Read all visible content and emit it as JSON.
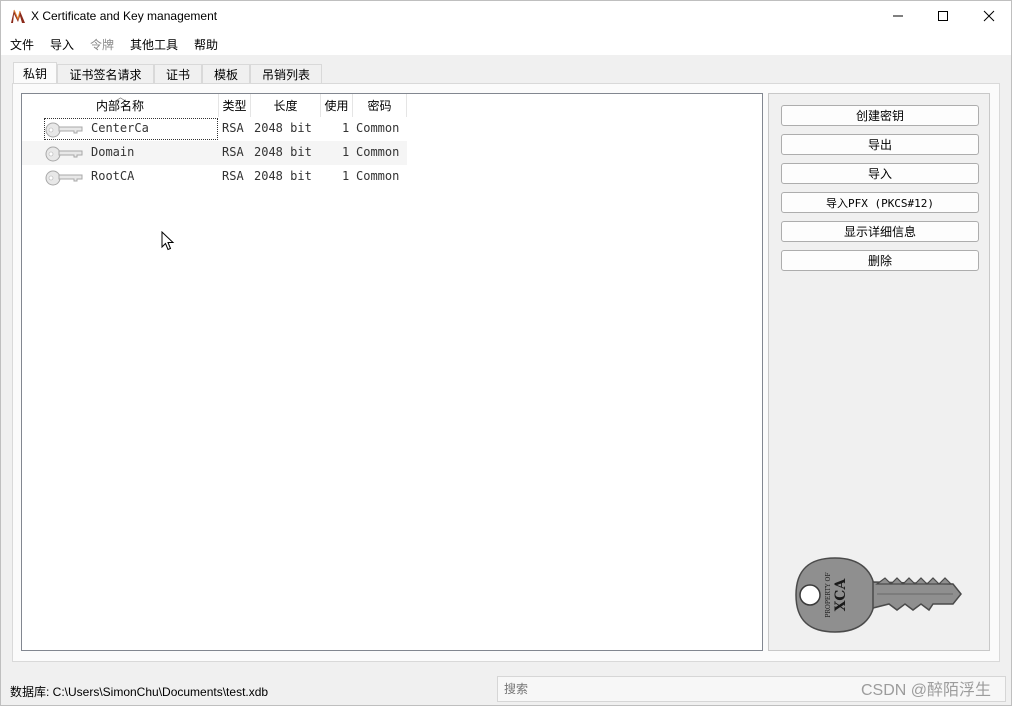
{
  "window": {
    "title": "X Certificate and Key management",
    "controls": [
      "minimize-icon",
      "maximize-icon",
      "close-icon"
    ]
  },
  "menu": {
    "items": [
      {
        "label": "文件",
        "enabled": true
      },
      {
        "label": "导入",
        "enabled": true
      },
      {
        "label": "令牌",
        "enabled": false
      },
      {
        "label": "其他工具",
        "enabled": true
      },
      {
        "label": "帮助",
        "enabled": true
      }
    ]
  },
  "tabs": [
    {
      "label": "私钥",
      "active": true
    },
    {
      "label": "证书签名请求",
      "active": false
    },
    {
      "label": "证书",
      "active": false
    },
    {
      "label": "模板",
      "active": false
    },
    {
      "label": "吊销列表",
      "active": false
    }
  ],
  "table": {
    "columns": [
      "内部名称",
      "类型",
      "长度",
      "使用",
      "密码"
    ],
    "rows": [
      {
        "name": "CenterCa",
        "type": "RSA",
        "length": "2048 bit",
        "use": "1",
        "password": "Common"
      },
      {
        "name": "Domain",
        "type": "RSA",
        "length": "2048 bit",
        "use": "1",
        "password": "Common"
      },
      {
        "name": "RootCA",
        "type": "RSA",
        "length": "2048 bit",
        "use": "1",
        "password": "Common"
      }
    ],
    "row_icon": "key-icon"
  },
  "actions": {
    "create": "创建密钥",
    "export": "导出",
    "import": "导入",
    "import_pfx": "导入PFX (PKCS#12)",
    "details": "显示详细信息",
    "delete": "删除"
  },
  "key_image": {
    "icon": "key-logo-icon",
    "text_small": "PROPERTY OF",
    "text_big": "XCA"
  },
  "status": {
    "db_label": "数据库: C:\\Users\\SimonChu\\Documents\\test.xdb",
    "search_placeholder": "搜索"
  },
  "watermark": "CSDN @醉陌浮生",
  "colors": {
    "panel_bg": "#f0f0f0",
    "list_bg": "#ffffff",
    "key_gray": "#8f8f8f"
  }
}
